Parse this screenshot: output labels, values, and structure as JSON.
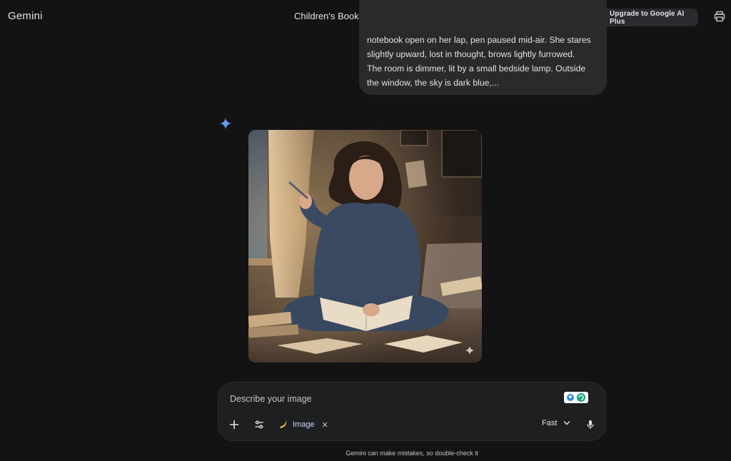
{
  "header": {
    "brand": "Gemini",
    "chat_title": "Children's Book Character Design Brief",
    "upgrade_label": "Upgrade to Google AI Plus"
  },
  "conversation": {
    "user_message_visible": "notebook open on her lap, pen paused mid-air. She stares slightly upward, lost in thought, brows lightly furrowed. The room is dimmer, lit by a small bedside lamp. Outside the window, the sky is dark blue,..."
  },
  "composer": {
    "placeholder": "Describe your image",
    "tool_chip_label": "Image",
    "chip_close": "✕",
    "mode_label": "Fast"
  },
  "footer": {
    "disclaimer": "Gemini can make mistakes, so double-check it"
  },
  "colors": {
    "background": "#131314",
    "bubble": "#282a2c",
    "composer": "#1e1f20",
    "accent_blue": "#4e86f0",
    "chip_text": "#c9d8ff"
  },
  "icons": {
    "title_dropdown": "chevron-down-icon",
    "upgrade": "gemini-spark-icon",
    "top_right": "print-icon",
    "avatar": "gemini-spark-icon",
    "add": "plus-icon",
    "tools": "tune-icon",
    "image_tool": "banana-icon",
    "mode_dropdown": "chevron-down-icon",
    "mic": "mic-icon",
    "extensions": "extension-icons"
  }
}
